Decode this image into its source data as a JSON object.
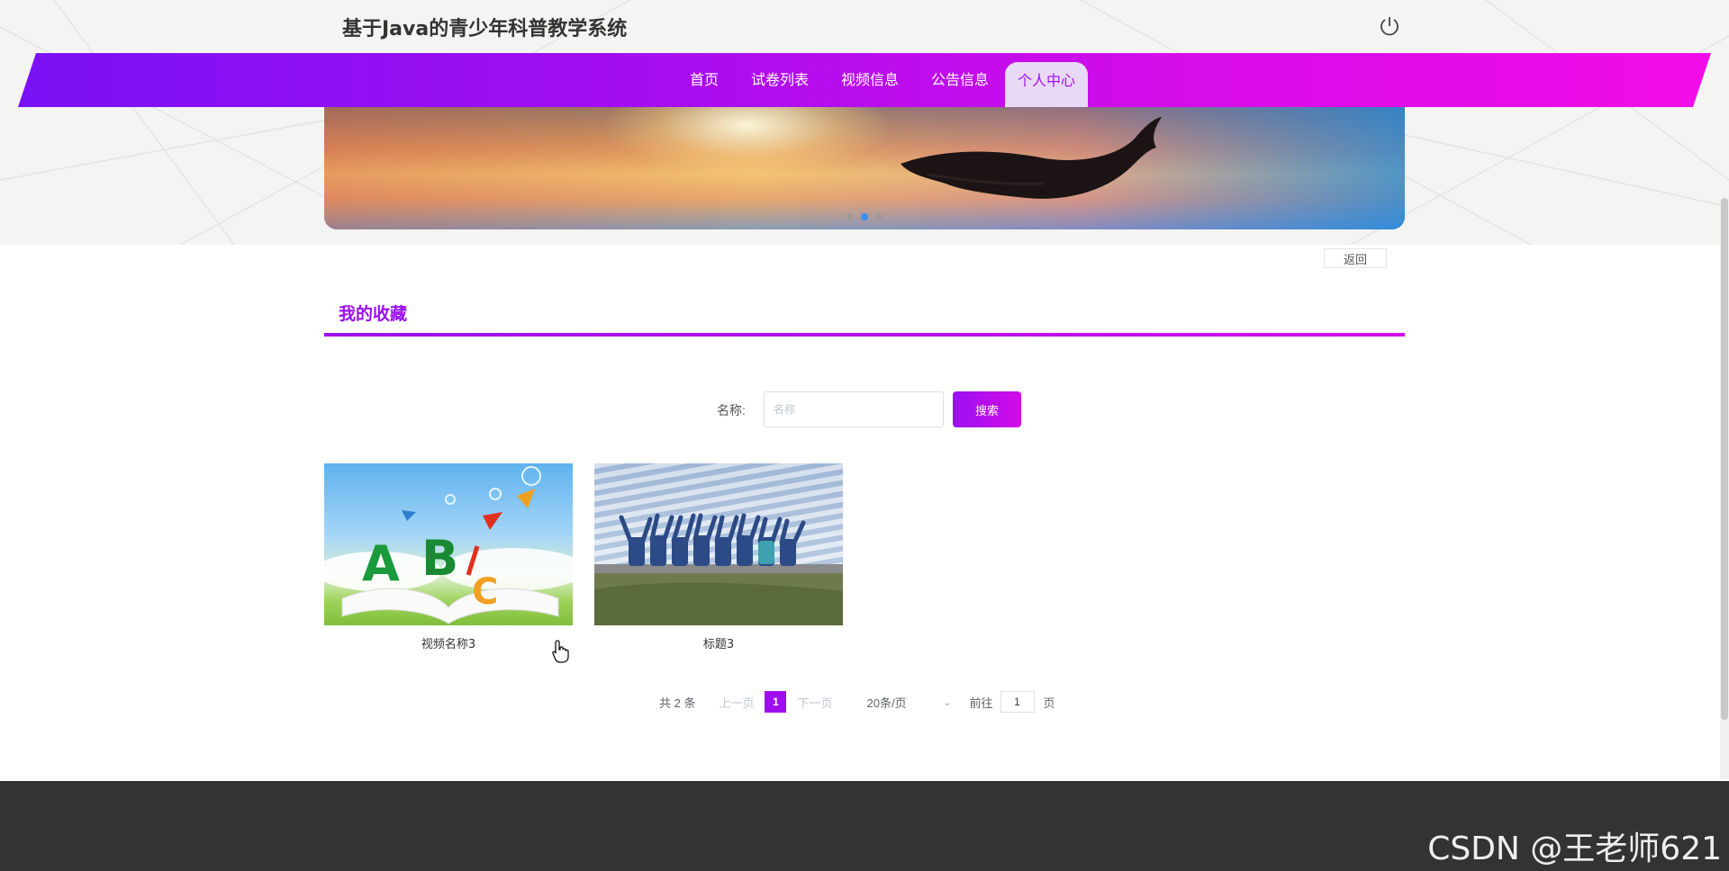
{
  "app": {
    "title": "基于Java的青少年科普教学系统"
  },
  "header": {
    "power_icon": "power-icon"
  },
  "nav": {
    "items": [
      {
        "label": "首页",
        "active": false
      },
      {
        "label": "试卷列表",
        "active": false
      },
      {
        "label": "视频信息",
        "active": false
      },
      {
        "label": "公告信息",
        "active": false
      },
      {
        "label": "个人中心",
        "active": true
      }
    ],
    "gradient_colors": [
      "#7a11f5",
      "#f20ce8"
    ]
  },
  "banner": {
    "slides": 3,
    "active_slide": 2
  },
  "back_label": "返回",
  "section": {
    "title": "我的收藏",
    "accent_color": "#9a0ff0"
  },
  "search": {
    "label": "名称:",
    "placeholder": "名称",
    "value": "",
    "button_label": "搜索"
  },
  "cards": [
    {
      "caption": "视频名称3",
      "image": "abc-book-illustration"
    },
    {
      "caption": "标题3",
      "image": "team-raising-arms-photo"
    }
  ],
  "pagination": {
    "total_text": "共 2 条",
    "prev_label": "上一页",
    "current_page": "1",
    "next_label": "下一页",
    "page_size_label": "20条/页",
    "goto_label": "前往",
    "goto_value": "1",
    "page_suffix": "页"
  },
  "watermark": "CSDN @王老师621"
}
